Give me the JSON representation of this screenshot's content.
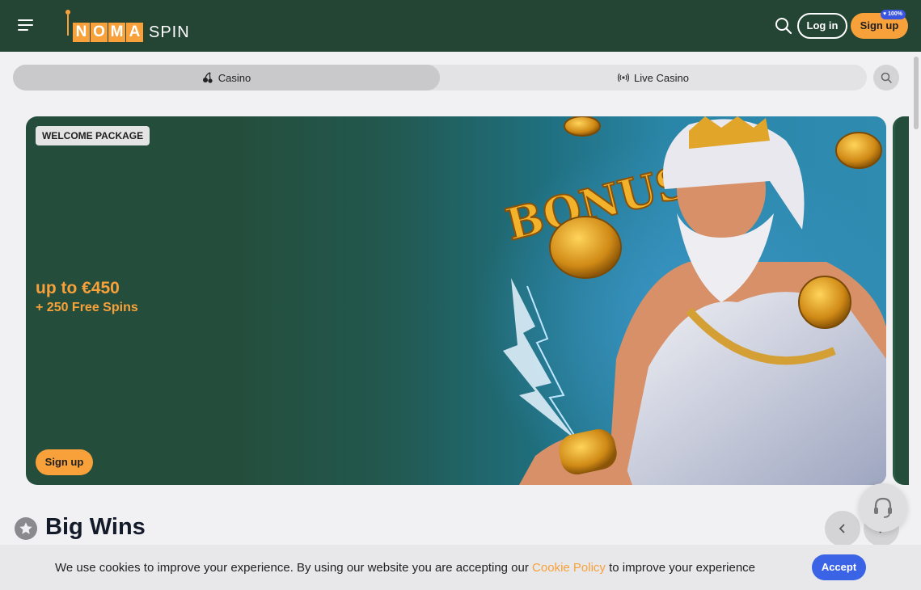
{
  "header": {
    "logo_letters": [
      "N",
      "O",
      "M",
      "A"
    ],
    "logo_suffix": "SPIN",
    "login_label": "Log in",
    "signup_label": "Sign up",
    "signup_badge": "100%"
  },
  "tabs": [
    {
      "label": "Casino",
      "icon": "cherries-icon",
      "active": true
    },
    {
      "label": "Live Casino",
      "icon": "broadcast-icon",
      "active": false
    }
  ],
  "banner": {
    "badge": "WELCOME PACKAGE",
    "headline": "up to €450",
    "subline": "+ 250 Free Spins",
    "cta": "Sign up",
    "art_text": "BONUS"
  },
  "big_wins": {
    "title": "Big Wins"
  },
  "cookie": {
    "text_before": "We use cookies to improve your experience. By using our website you are accepting our ",
    "link": "Cookie Policy",
    "text_after": " to improve your experience",
    "accept_label": "Accept"
  },
  "colors": {
    "header_bg": "#244434",
    "accent": "#f8a13a",
    "accept": "#3a63e6",
    "page_bg": "#f1f1f3"
  }
}
